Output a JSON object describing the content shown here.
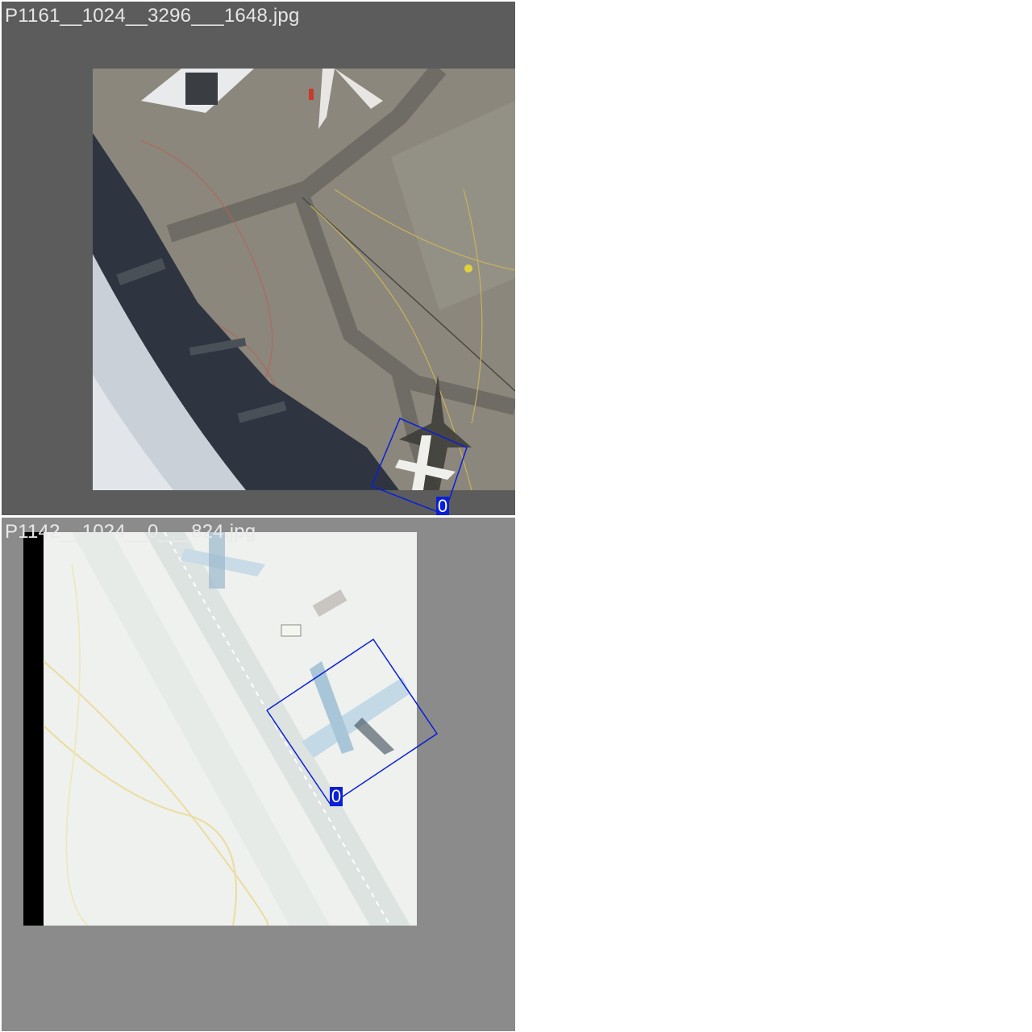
{
  "mosaic": {
    "tiles": [
      {
        "filename": "P1161__1024__3296___1648.jpg",
        "detections": [
          {
            "class_label": "0",
            "color": "#0a1fd6"
          }
        ]
      },
      {
        "filename": "P1142__1024__0___824.jpg",
        "detections": [
          {
            "class_label": "0",
            "color": "#0a1fd6"
          }
        ]
      }
    ]
  }
}
